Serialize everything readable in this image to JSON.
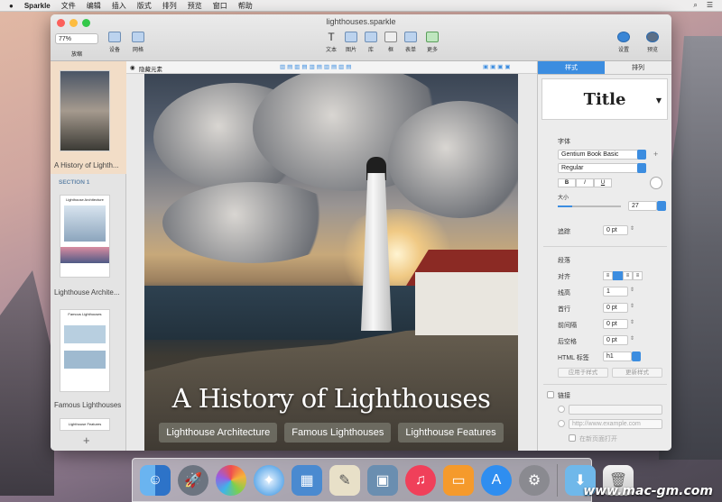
{
  "menubar": {
    "app_name": "Sparkle",
    "items": [
      "文件",
      "编辑",
      "插入",
      "版式",
      "排列",
      "预览",
      "窗口",
      "帮助"
    ]
  },
  "window": {
    "title": "lighthouses.sparkle",
    "zoom": "77%",
    "toolbar_left": [
      {
        "label": "放缩"
      },
      {
        "label": "设备"
      },
      {
        "label": "网格"
      }
    ],
    "toolbar_center": [
      {
        "label": "文本",
        "icon": "text-icon"
      },
      {
        "label": "图片",
        "icon": "image-icon"
      },
      {
        "label": "库",
        "icon": "library-icon"
      },
      {
        "label": "框",
        "icon": "box-icon"
      },
      {
        "label": "表单",
        "icon": "form-icon"
      },
      {
        "label": "更多",
        "icon": "more-icon"
      }
    ],
    "toolbar_right": [
      {
        "label": "设置",
        "icon": "info-icon"
      },
      {
        "label": "预览",
        "icon": "preview-icon"
      }
    ]
  },
  "sidebar": {
    "pages": [
      {
        "label": "A History of Lighth..."
      },
      {
        "label": "Lighthouse Archite..."
      },
      {
        "label": "Famous Lighthouses"
      }
    ],
    "section_label": "SECTION 1",
    "thumb_small_texts": [
      "Lighthouse Architecture",
      "Famous Lighthouses",
      "Lighthouse Features"
    ]
  },
  "ruler": {
    "hide_label": "隐藏元素"
  },
  "page": {
    "title": "A History of Lighthouses",
    "buttons": [
      "Lighthouse Architecture",
      "Famous Lighthouses",
      "Lighthouse Features"
    ]
  },
  "inspector": {
    "tabs": [
      "样式",
      "排列"
    ],
    "active_tab": "样式",
    "style_name": "Title",
    "font_section": "字体",
    "font_family": "Gentium Book Basic",
    "font_style": "Regular",
    "bold": "B",
    "italic": "I",
    "underline": "U",
    "size_label": "大小",
    "size_value": "27",
    "tracking_label": "追踪",
    "tracking_value": "0 pt",
    "paragraph_section": "段落",
    "align_label": "对齐",
    "line_height_label": "线高",
    "line_height_value": "1",
    "indent_label": "首行",
    "indent_value": "0 pt",
    "space_before_label": "前间隔",
    "space_before_value": "0 pt",
    "space_after_label": "后空格",
    "space_after_value": "0 pt",
    "html_tag_label": "HTML 标签",
    "html_tag_value": "h1",
    "apply_style": "应用于样式",
    "update_style": "更新样式",
    "link_label": "链接",
    "url_placeholder": "http://www.example.com",
    "new_window_label": "在新页面打开"
  },
  "dock": {
    "icons": [
      "finder-icon",
      "launchpad-icon",
      "photos-icon",
      "safari-icon",
      "preview-icon",
      "script-icon",
      "sparkle-icon",
      "music-icon",
      "books-icon",
      "appstore-icon",
      "settings-icon",
      "downloads-icon",
      "trash-icon"
    ]
  },
  "watermark": "www.mac-gm.com",
  "colors": {
    "accent": "#3c8de0",
    "selection": "#f2ddc7"
  }
}
